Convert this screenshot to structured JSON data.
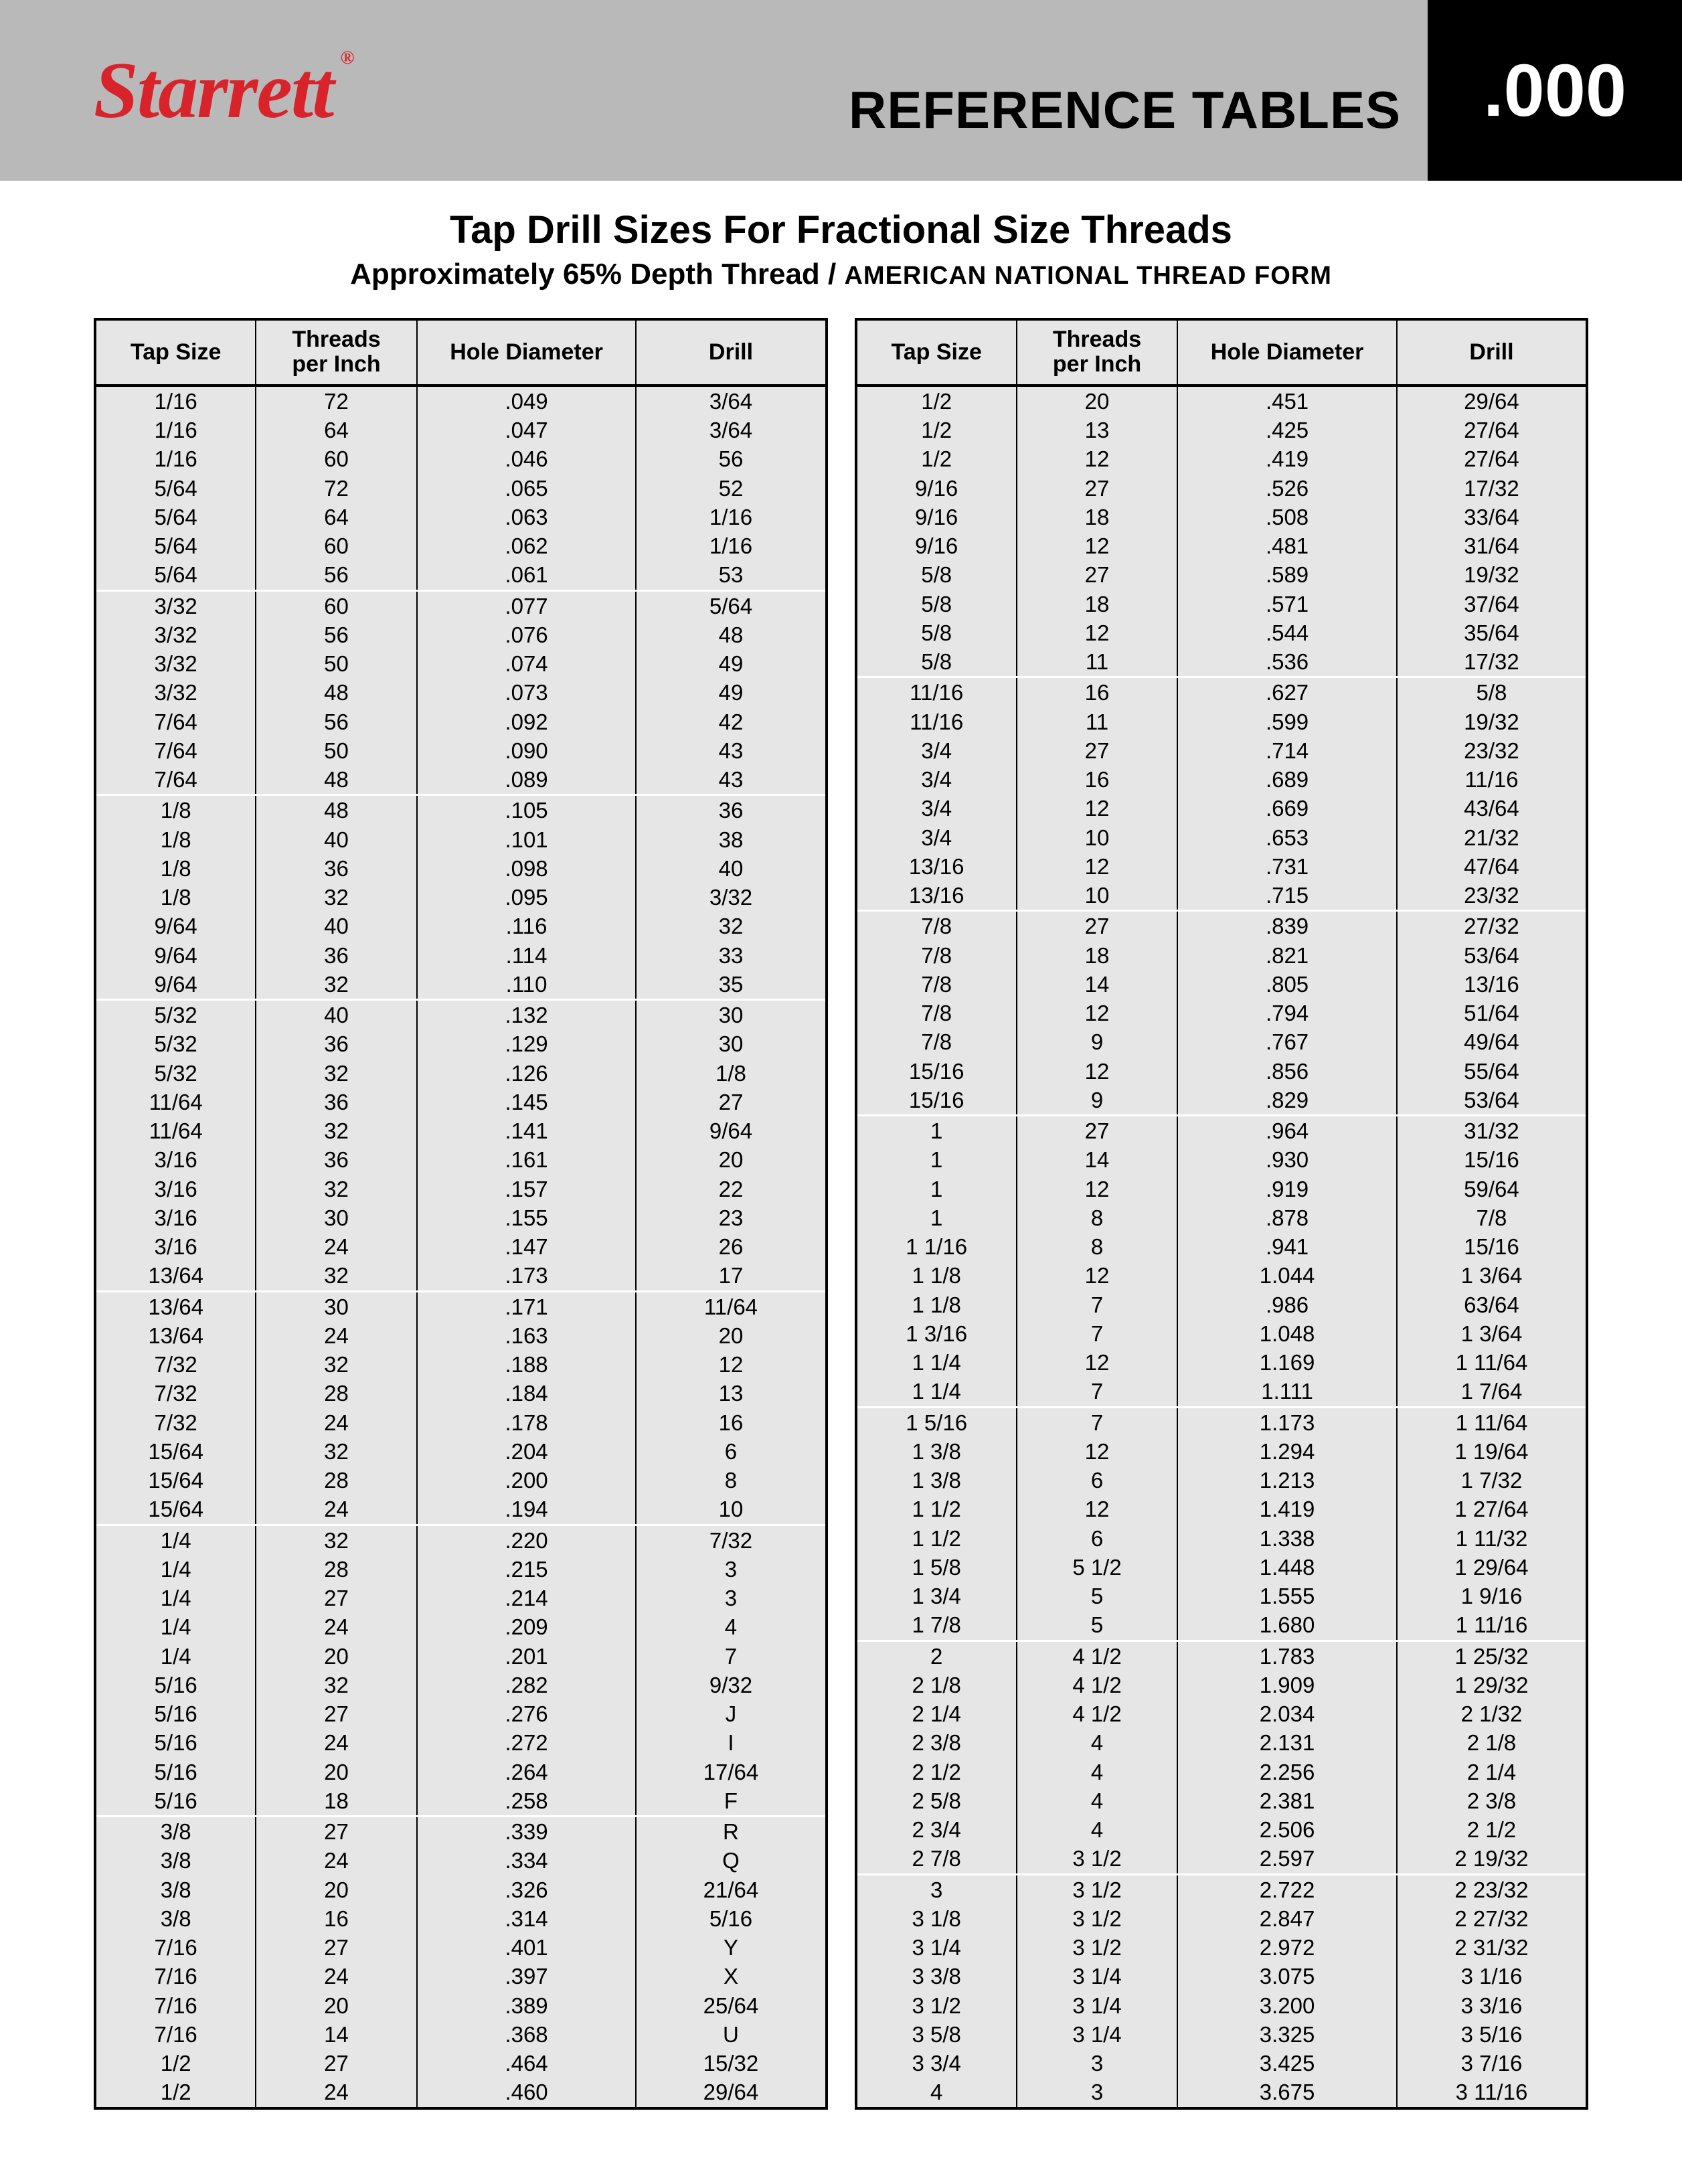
{
  "header": {
    "logo": "Starrett",
    "logo_r": "®",
    "ref_title": "REFERENCE TABLES",
    "section": ".000"
  },
  "title": "Tap Drill Sizes For Fractional Size Threads",
  "subtitle_a": "Approximately 65% Depth Thread / ",
  "subtitle_b": "AMERICAN NATIONAL THREAD FORM",
  "columns": [
    "Tap Size",
    "Threads\nper Inch",
    "Hole Diameter",
    "Drill"
  ],
  "left_groups": [
    [
      [
        "1/16",
        "72",
        ".049",
        "3/64"
      ],
      [
        "1/16",
        "64",
        ".047",
        "3/64"
      ],
      [
        "1/16",
        "60",
        ".046",
        "56"
      ],
      [
        "5/64",
        "72",
        ".065",
        "52"
      ],
      [
        "5/64",
        "64",
        ".063",
        "1/16"
      ],
      [
        "5/64",
        "60",
        ".062",
        "1/16"
      ],
      [
        "5/64",
        "56",
        ".061",
        "53"
      ]
    ],
    [
      [
        "3/32",
        "60",
        ".077",
        "5/64"
      ],
      [
        "3/32",
        "56",
        ".076",
        "48"
      ],
      [
        "3/32",
        "50",
        ".074",
        "49"
      ],
      [
        "3/32",
        "48",
        ".073",
        "49"
      ],
      [
        "7/64",
        "56",
        ".092",
        "42"
      ],
      [
        "7/64",
        "50",
        ".090",
        "43"
      ],
      [
        "7/64",
        "48",
        ".089",
        "43"
      ]
    ],
    [
      [
        "1/8",
        "48",
        ".105",
        "36"
      ],
      [
        "1/8",
        "40",
        ".101",
        "38"
      ],
      [
        "1/8",
        "36",
        ".098",
        "40"
      ],
      [
        "1/8",
        "32",
        ".095",
        "3/32"
      ],
      [
        "9/64",
        "40",
        ".116",
        "32"
      ],
      [
        "9/64",
        "36",
        ".114",
        "33"
      ],
      [
        "9/64",
        "32",
        ".110",
        "35"
      ]
    ],
    [
      [
        "5/32",
        "40",
        ".132",
        "30"
      ],
      [
        "5/32",
        "36",
        ".129",
        "30"
      ],
      [
        "5/32",
        "32",
        ".126",
        "1/8"
      ],
      [
        "11/64",
        "36",
        ".145",
        "27"
      ],
      [
        "11/64",
        "32",
        ".141",
        "9/64"
      ],
      [
        "3/16",
        "36",
        ".161",
        "20"
      ],
      [
        "3/16",
        "32",
        ".157",
        "22"
      ],
      [
        "3/16",
        "30",
        ".155",
        "23"
      ],
      [
        "3/16",
        "24",
        ".147",
        "26"
      ],
      [
        "13/64",
        "32",
        ".173",
        "17"
      ]
    ],
    [
      [
        "13/64",
        "30",
        ".171",
        "11/64"
      ],
      [
        "13/64",
        "24",
        ".163",
        "20"
      ],
      [
        "7/32",
        "32",
        ".188",
        "12"
      ],
      [
        "7/32",
        "28",
        ".184",
        "13"
      ],
      [
        "7/32",
        "24",
        ".178",
        "16"
      ],
      [
        "15/64",
        "32",
        ".204",
        "6"
      ],
      [
        "15/64",
        "28",
        ".200",
        "8"
      ],
      [
        "15/64",
        "24",
        ".194",
        "10"
      ]
    ],
    [
      [
        "1/4",
        "32",
        ".220",
        "7/32"
      ],
      [
        "1/4",
        "28",
        ".215",
        "3"
      ],
      [
        "1/4",
        "27",
        ".214",
        "3"
      ],
      [
        "1/4",
        "24",
        ".209",
        "4"
      ],
      [
        "1/4",
        "20",
        ".201",
        "7"
      ],
      [
        "5/16",
        "32",
        ".282",
        "9/32"
      ],
      [
        "5/16",
        "27",
        ".276",
        "J"
      ],
      [
        "5/16",
        "24",
        ".272",
        "I"
      ],
      [
        "5/16",
        "20",
        ".264",
        "17/64"
      ],
      [
        "5/16",
        "18",
        ".258",
        "F"
      ]
    ],
    [
      [
        "3/8",
        "27",
        ".339",
        "R"
      ],
      [
        "3/8",
        "24",
        ".334",
        "Q"
      ],
      [
        "3/8",
        "20",
        ".326",
        "21/64"
      ],
      [
        "3/8",
        "16",
        ".314",
        "5/16"
      ],
      [
        "7/16",
        "27",
        ".401",
        "Y"
      ],
      [
        "7/16",
        "24",
        ".397",
        "X"
      ],
      [
        "7/16",
        "20",
        ".389",
        "25/64"
      ],
      [
        "7/16",
        "14",
        ".368",
        "U"
      ],
      [
        "1/2",
        "27",
        ".464",
        "15/32"
      ],
      [
        "1/2",
        "24",
        ".460",
        "29/64"
      ]
    ]
  ],
  "right_groups": [
    [
      [
        "1/2",
        "20",
        ".451",
        "29/64"
      ],
      [
        "1/2",
        "13",
        ".425",
        "27/64"
      ],
      [
        "1/2",
        "12",
        ".419",
        "27/64"
      ],
      [
        "9/16",
        "27",
        ".526",
        "17/32"
      ],
      [
        "9/16",
        "18",
        ".508",
        "33/64"
      ],
      [
        "9/16",
        "12",
        ".481",
        "31/64"
      ],
      [
        "5/8",
        "27",
        ".589",
        "19/32"
      ],
      [
        "5/8",
        "18",
        ".571",
        "37/64"
      ],
      [
        "5/8",
        "12",
        ".544",
        "35/64"
      ],
      [
        "5/8",
        "11",
        ".536",
        "17/32"
      ]
    ],
    [
      [
        "11/16",
        "16",
        ".627",
        "5/8"
      ],
      [
        "11/16",
        "11",
        ".599",
        "19/32"
      ],
      [
        "3/4",
        "27",
        ".714",
        "23/32"
      ],
      [
        "3/4",
        "16",
        ".689",
        "11/16"
      ],
      [
        "3/4",
        "12",
        ".669",
        "43/64"
      ],
      [
        "3/4",
        "10",
        ".653",
        "21/32"
      ],
      [
        "13/16",
        "12",
        ".731",
        "47/64"
      ],
      [
        "13/16",
        "10",
        ".715",
        "23/32"
      ]
    ],
    [
      [
        "7/8",
        "27",
        ".839",
        "27/32"
      ],
      [
        "7/8",
        "18",
        ".821",
        "53/64"
      ],
      [
        "7/8",
        "14",
        ".805",
        "13/16"
      ],
      [
        "7/8",
        "12",
        ".794",
        "51/64"
      ],
      [
        "7/8",
        "9",
        ".767",
        "49/64"
      ],
      [
        "15/16",
        "12",
        ".856",
        "55/64"
      ],
      [
        "15/16",
        "9",
        ".829",
        "53/64"
      ]
    ],
    [
      [
        "1",
        "27",
        ".964",
        "31/32"
      ],
      [
        "1",
        "14",
        ".930",
        "15/16"
      ],
      [
        "1",
        "12",
        ".919",
        "59/64"
      ],
      [
        "1",
        "8",
        ".878",
        "7/8"
      ],
      [
        "1 1/16",
        "8",
        ".941",
        "15/16"
      ],
      [
        "1 1/8",
        "12",
        "1.044",
        "1 3/64"
      ],
      [
        "1 1/8",
        "7",
        ".986",
        "63/64"
      ],
      [
        "1 3/16",
        "7",
        "1.048",
        "1 3/64"
      ],
      [
        "1 1/4",
        "12",
        "1.169",
        "1 11/64"
      ],
      [
        "1 1/4",
        "7",
        "1.111",
        "1 7/64"
      ]
    ],
    [
      [
        "1 5/16",
        "7",
        "1.173",
        "1 11/64"
      ],
      [
        "1 3/8",
        "12",
        "1.294",
        "1 19/64"
      ],
      [
        "1 3/8",
        "6",
        "1.213",
        "1 7/32"
      ],
      [
        "1 1/2",
        "12",
        "1.419",
        "1 27/64"
      ],
      [
        "1 1/2",
        "6",
        "1.338",
        "1 11/32"
      ],
      [
        "1 5/8",
        "5 1/2",
        "1.448",
        "1 29/64"
      ],
      [
        "1 3/4",
        "5",
        "1.555",
        "1 9/16"
      ],
      [
        "1 7/8",
        "5",
        "1.680",
        "1 11/16"
      ]
    ],
    [
      [
        "2",
        "4 1/2",
        "1.783",
        "1 25/32"
      ],
      [
        "2 1/8",
        "4 1/2",
        "1.909",
        "1 29/32"
      ],
      [
        "2 1/4",
        "4 1/2",
        "2.034",
        "2 1/32"
      ],
      [
        "2 3/8",
        "4",
        "2.131",
        "2 1/8"
      ],
      [
        "2 1/2",
        "4",
        "2.256",
        "2 1/4"
      ],
      [
        "2 5/8",
        "4",
        "2.381",
        "2 3/8"
      ],
      [
        "2 3/4",
        "4",
        "2.506",
        "2 1/2"
      ],
      [
        "2 7/8",
        "3 1/2",
        "2.597",
        "2 19/32"
      ]
    ],
    [
      [
        "3",
        "3 1/2",
        "2.722",
        "2 23/32"
      ],
      [
        "3 1/8",
        "3 1/2",
        "2.847",
        "2 27/32"
      ],
      [
        "3 1/4",
        "3 1/2",
        "2.972",
        "2 31/32"
      ],
      [
        "3 3/8",
        "3 1/4",
        "3.075",
        "3 1/16"
      ],
      [
        "3 1/2",
        "3 1/4",
        "3.200",
        "3 3/16"
      ],
      [
        "3 5/8",
        "3 1/4",
        "3.325",
        "3 5/16"
      ],
      [
        "3 3/4",
        "3",
        "3.425",
        "3 7/16"
      ],
      [
        "4",
        "3",
        "3.675",
        "3 11/16"
      ]
    ]
  ]
}
